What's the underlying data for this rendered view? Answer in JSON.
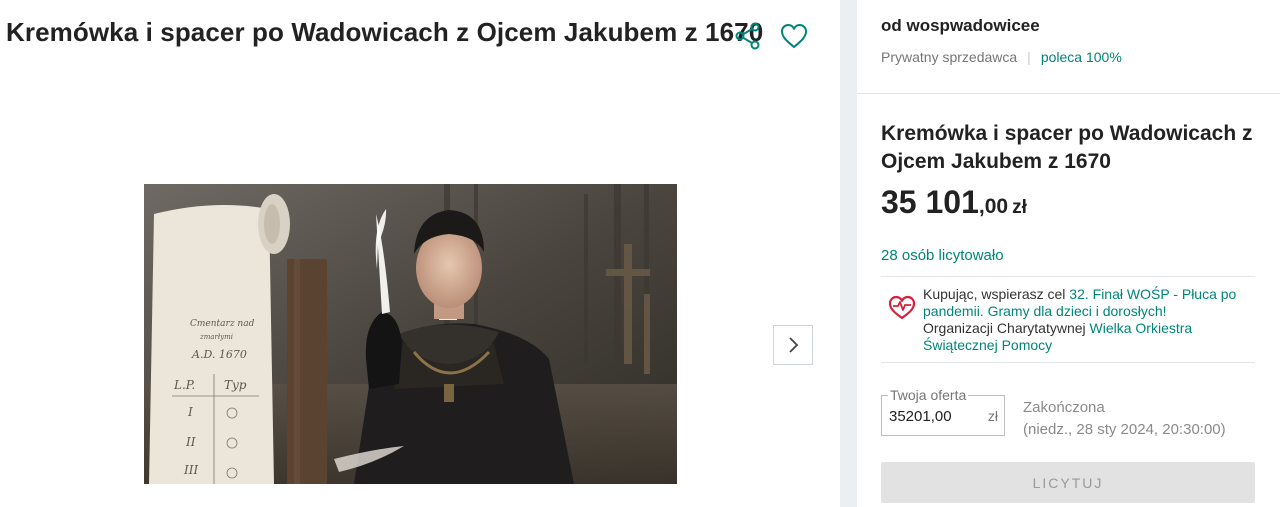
{
  "listing": {
    "title": "Kremówka i spacer po Wadowicach z Ojcem Jakubem z 1670"
  },
  "icons": {
    "share": "share-icon",
    "favorite": "heart-icon",
    "next": "chevron-right-icon",
    "charity": "wosp-heart-icon"
  },
  "colors": {
    "accent": "#00857a",
    "charity": "#d6203a",
    "disabled_button": "#e2e2e2"
  },
  "seller": {
    "name": "od wospwadowicee",
    "type": "Prywatny sprzedawca",
    "recommend": "poleca 100%"
  },
  "offer": {
    "title": "Kremówka i spacer po Wadowicach z Ojcem Jakubem z 1670",
    "price_main": "35 101",
    "price_decimals": ",00",
    "currency": "zł",
    "bidders": "28 osób licytowało"
  },
  "charity": {
    "prefix": "Kupując, wspierasz cel ",
    "goal": "32. Finał WOŚP - Płuca po pandemii. Gramy dla dzieci i dorosłych!",
    "org_prefix": "Organizacji Charytatywnej ",
    "org": "Wielka Orkiestra Świątecznej Pomocy"
  },
  "bid": {
    "legend": "Twoja oferta",
    "value": "35201,00",
    "currency": "zł",
    "status": "Zakończona",
    "end_date": "(niedz., 28 sty 2024, 20:30:00)",
    "button": "LICYTUJ"
  },
  "photo_scroll": {
    "sheet_lines": [
      "Cmentarz nad",
      "zmarłymi",
      "A.D. 1670",
      "L.P.   Typ",
      "I",
      "II",
      "III"
    ]
  }
}
